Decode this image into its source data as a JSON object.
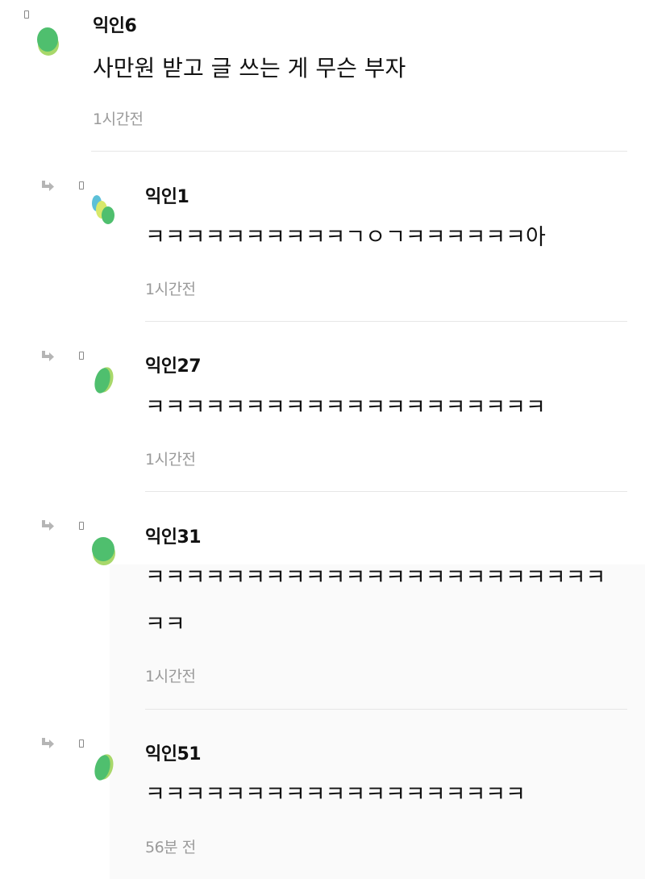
{
  "comments": [
    {
      "author": "익인6",
      "text_lines": [
        "사만원 받고 글 쓰는 게 무슨 부자"
      ],
      "time": "1시간전",
      "is_reply": false,
      "avatar_icon": "green-leaf-avatar-icon"
    },
    {
      "author": "익인1",
      "text_lines": [
        "ㅋㅋㅋㅋㅋㅋㅋㅋㅋㅋㄱㅇㄱㅋㅋㅋㅋㅋㅋ아"
      ],
      "time": "1시간전",
      "is_reply": true,
      "avatar_icon": "multicolor-leaf-avatar-icon"
    },
    {
      "author": "익인27",
      "text_lines": [
        "ㅋㅋㅋㅋㅋㅋㅋㅋㅋㅋㅋㅋㅋㅋㅋㅋㅋㅋㅋㅋ"
      ],
      "time": "1시간전",
      "is_reply": true,
      "avatar_icon": "green-leaf-avatar-icon"
    },
    {
      "author": "익인31",
      "text_lines": [
        "ㅋㅋㅋㅋㅋㅋㅋㅋㅋㅋㅋㅋㅋㅋㅋㅋㅋㅋㅋㅋㅋㅋㅋ",
        "ㅋㅋ"
      ],
      "time": "1시간전",
      "is_reply": true,
      "avatar_icon": "green-leaf-avatar-icon"
    },
    {
      "author": "익인51",
      "text_lines": [
        "ㅋㅋㅋㅋㅋㅋㅋㅋㅋㅋㅋㅋㅋㅋㅋㅋㅋㅋㅋ"
      ],
      "time": "56분 전",
      "is_reply": true,
      "avatar_icon": "green-leaf-avatar-icon"
    }
  ],
  "colors": {
    "leaf_green": "#4fbf6e",
    "leaf_light": "#a8d86a",
    "leaf_teal": "#5cc0d8",
    "time_gray": "#9a9a9a",
    "divider": "#e6e6e6"
  }
}
